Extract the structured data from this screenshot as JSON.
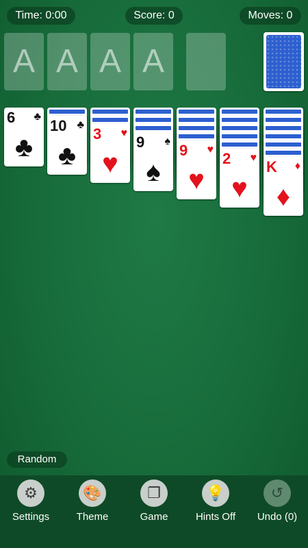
{
  "header": {
    "time": "Time: 0:00",
    "score": "Score: 0",
    "moves": "Moves: 0"
  },
  "foundations": [
    "A",
    "A",
    "A",
    "A"
  ],
  "tableau": [
    {
      "hidden": 0,
      "rank": "6",
      "suit": "♣",
      "color": "black"
    },
    {
      "hidden": 1,
      "rank": "10",
      "suit": "♣",
      "color": "black"
    },
    {
      "hidden": 2,
      "rank": "3",
      "suit": "♥",
      "color": "red"
    },
    {
      "hidden": 3,
      "rank": "9",
      "suit": "♠",
      "color": "black"
    },
    {
      "hidden": 4,
      "rank": "9",
      "suit": "♥",
      "color": "red"
    },
    {
      "hidden": 5,
      "rank": "2",
      "suit": "♥",
      "color": "red"
    },
    {
      "hidden": 6,
      "rank": "K",
      "suit": "♦",
      "color": "red"
    }
  ],
  "random_label": "Random",
  "toolbar": [
    {
      "label": "Settings",
      "icon": "gear-icon",
      "glyph": "⚙"
    },
    {
      "label": "Theme",
      "icon": "palette-icon",
      "glyph": "🎨"
    },
    {
      "label": "Game",
      "icon": "cards-icon",
      "glyph": "❐"
    },
    {
      "label": "Hints Off",
      "icon": "lightbulb-icon",
      "glyph": "💡"
    },
    {
      "label": "Undo (0)",
      "icon": "undo-icon",
      "glyph": "↺"
    }
  ]
}
